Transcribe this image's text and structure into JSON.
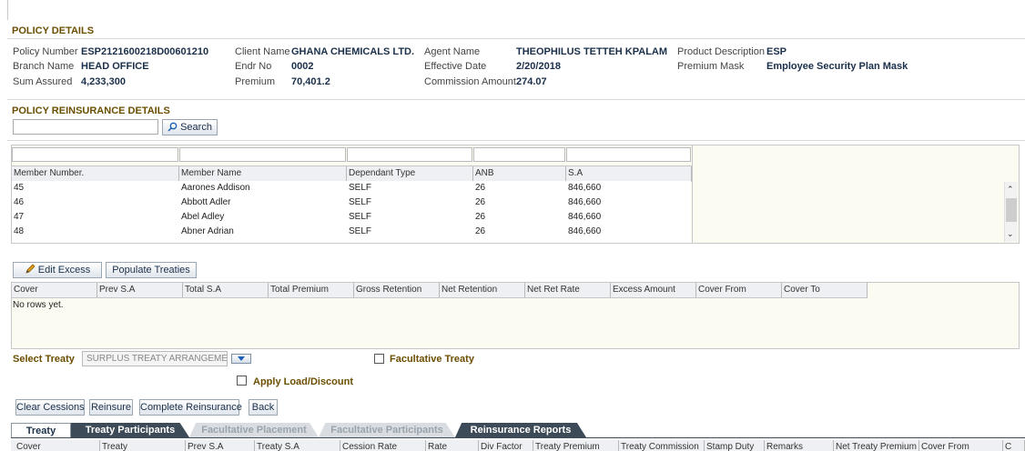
{
  "policy_details": {
    "title": "POLICY DETAILS",
    "fields": {
      "policy_number": {
        "label": "Policy Number",
        "value": "ESP2121600218D00601210"
      },
      "branch_name": {
        "label": "Branch Name",
        "value": "HEAD OFFICE"
      },
      "sum_assured": {
        "label": "Sum Assured",
        "value": "4,233,300"
      },
      "client_name": {
        "label": "Client Name",
        "value": "GHANA CHEMICALS LTD."
      },
      "endr_no": {
        "label": "Endr No",
        "value": "0002"
      },
      "premium": {
        "label": "Premium",
        "value": "70,401.2"
      },
      "agent_name": {
        "label": "Agent Name",
        "value": "THEOPHILUS TETTEH KPALAM"
      },
      "effective_date": {
        "label": "Effective Date",
        "value": "2/20/2018"
      },
      "commission_amount": {
        "label": "Commission Amount",
        "value": "274.07"
      },
      "product_description": {
        "label": "Product Description",
        "value": "ESP"
      },
      "premium_mask": {
        "label": "Premium Mask",
        "value": "Employee Security Plan Mask"
      }
    }
  },
  "reinsurance": {
    "title": "POLICY REINSURANCE DETAILS",
    "search_input_value": "",
    "search_button": "Search",
    "members_table": {
      "columns": [
        "Member Number.",
        "Member Name",
        "Dependant Type",
        "ANB",
        "S.A"
      ],
      "rows": [
        [
          "45",
          "Aarones Addison",
          "SELF",
          "26",
          "846,660"
        ],
        [
          "46",
          "Abbott Adler",
          "SELF",
          "26",
          "846,660"
        ],
        [
          "47",
          "Abel Adley",
          "SELF",
          "26",
          "846,660"
        ],
        [
          "48",
          "Abner Adrian",
          "SELF",
          "26",
          "846,660"
        ]
      ],
      "scroll_position": 0.3
    },
    "edit_excess_button": "Edit Excess",
    "populate_treaties_button": "Populate Treaties",
    "excess_table": {
      "columns": [
        "Cover",
        "Prev S.A",
        "Total S.A",
        "Total Premium",
        "Gross Retention",
        "Net Retention",
        "Net Ret Rate",
        "Excess Amount",
        "Cover From",
        "Cover To"
      ],
      "empty_text": "No rows yet."
    },
    "select_treaty": {
      "label": "Select Treaty",
      "value": "SURPLUS TREATY ARRANGEMEN"
    },
    "facultative_treaty": {
      "label": "Facultative Treaty",
      "checked": false
    },
    "apply_load_discount": {
      "label": "Apply Load/Discount",
      "checked": false
    },
    "actions": {
      "clear_cessions": "Clear Cessions",
      "reinsure": "Reinsure",
      "complete_reinsurance": "Complete Reinsurance",
      "back": "Back"
    },
    "tabs": [
      {
        "label": "Treaty",
        "state": "active"
      },
      {
        "label": "Treaty Participants",
        "state": "enabled"
      },
      {
        "label": "Facultative Placement",
        "state": "disabled"
      },
      {
        "label": "Facultative Participants",
        "state": "disabled"
      },
      {
        "label": "Reinsurance Reports",
        "state": "enabled"
      }
    ],
    "treaty_table_columns": [
      "Cover",
      "Treaty",
      "Prev S.A",
      "Treaty S.A",
      "Cession Rate",
      "Rate",
      "Div Factor",
      "Treaty Premium",
      "Treaty Commission",
      "Stamp Duty",
      "Remarks",
      "Net Treaty Premium",
      "Cover From",
      "C"
    ]
  },
  "colors": {
    "section_title": "#6b4e00",
    "value_text": "#1a2f4a",
    "tab_dark": "#3d4a57",
    "tab_active": "#ffffff",
    "tab_disabled": "#d9dde1",
    "grid_bg": "#fbfbf2"
  }
}
